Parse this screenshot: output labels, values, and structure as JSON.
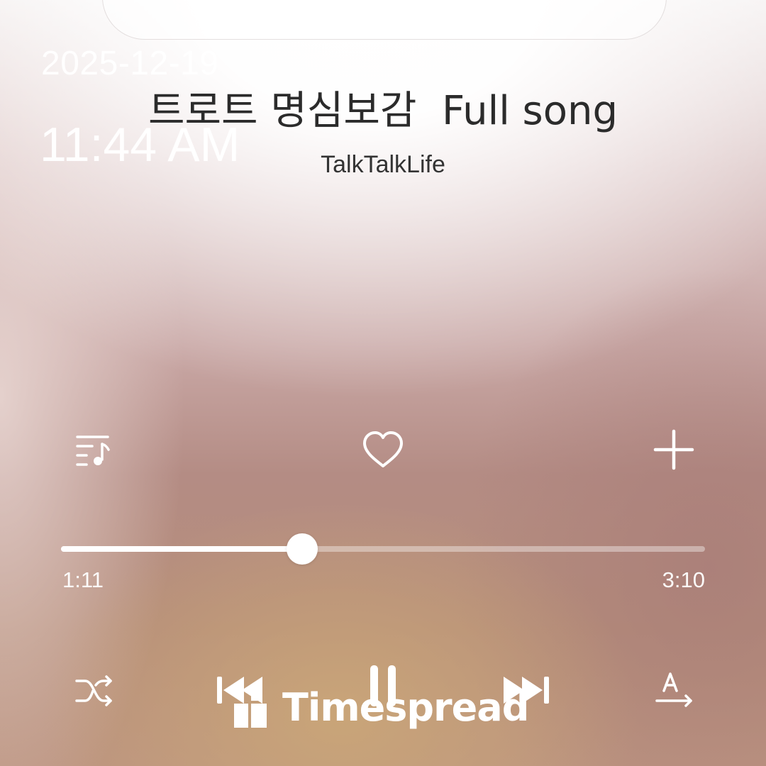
{
  "overlay": {
    "date": "2025-12-19",
    "time": "11:44 AM",
    "watermark": "Timespread"
  },
  "track": {
    "title": "트로트 명심보감  Full song",
    "artist": "TalkTalkLife"
  },
  "playback": {
    "elapsed": "1:11",
    "duration": "3:10",
    "progress_fraction": 0.374,
    "state": "playing"
  },
  "actions": {
    "queue_icon": "queue-music-icon",
    "favorite_icon": "heart-outline-icon",
    "add_icon": "plus-icon"
  },
  "controls": {
    "shuffle_icon": "shuffle-icon",
    "previous_icon": "skip-previous-icon",
    "play_pause_icon": "pause-icon",
    "next_icon": "skip-next-icon",
    "lyrics_icon": "lyrics-translate-icon"
  },
  "colors": {
    "accent": "#ffffff",
    "title_text": "#2b2b2b"
  }
}
